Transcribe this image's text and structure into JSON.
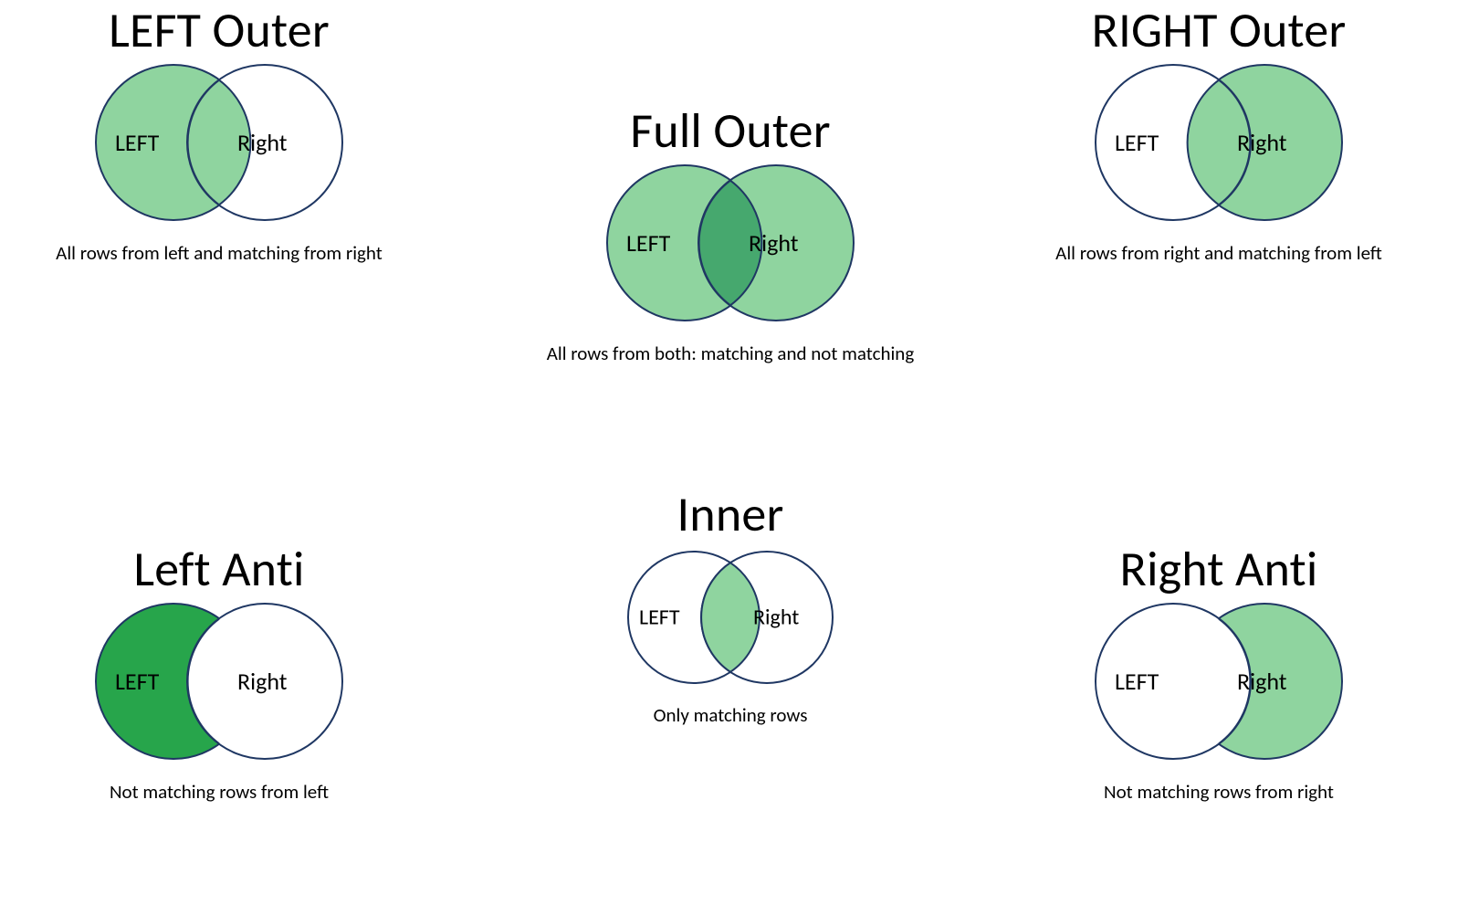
{
  "colors": {
    "outline": "#1f3763",
    "fill_light": "#8fd49f",
    "fill_dark": "#27a54b",
    "overlap_dark": "#46a86e"
  },
  "labels": {
    "left": "LEFT",
    "right": "Right"
  },
  "joins": {
    "left_outer": {
      "title": "LEFT Outer",
      "desc": "All rows from left and matching from right"
    },
    "right_outer": {
      "title": "RIGHT Outer",
      "desc": "All rows from right and matching from left"
    },
    "full_outer": {
      "title": "Full Outer",
      "desc": "All rows from both: matching and not matching"
    },
    "left_anti": {
      "title": "Left Anti",
      "desc": "Not matching rows from left"
    },
    "inner": {
      "title": "Inner",
      "desc": "Only matching rows"
    },
    "right_anti": {
      "title": "Right Anti",
      "desc": "Not matching rows from right"
    }
  },
  "chart_data": [
    {
      "type": "venn",
      "name": "LEFT Outer",
      "shaded": [
        "left_only",
        "intersection"
      ],
      "overlap_darker": false
    },
    {
      "type": "venn",
      "name": "RIGHT Outer",
      "shaded": [
        "right_only",
        "intersection"
      ],
      "overlap_darker": false
    },
    {
      "type": "venn",
      "name": "Full Outer",
      "shaded": [
        "left_only",
        "intersection",
        "right_only"
      ],
      "overlap_darker": true
    },
    {
      "type": "venn",
      "name": "Left Anti",
      "shaded": [
        "left_only"
      ],
      "overlap_darker": false,
      "fill_darker": true
    },
    {
      "type": "venn",
      "name": "Inner",
      "shaded": [
        "intersection"
      ],
      "overlap_darker": false
    },
    {
      "type": "venn",
      "name": "Right Anti",
      "shaded": [
        "right_only"
      ],
      "overlap_darker": false
    }
  ]
}
